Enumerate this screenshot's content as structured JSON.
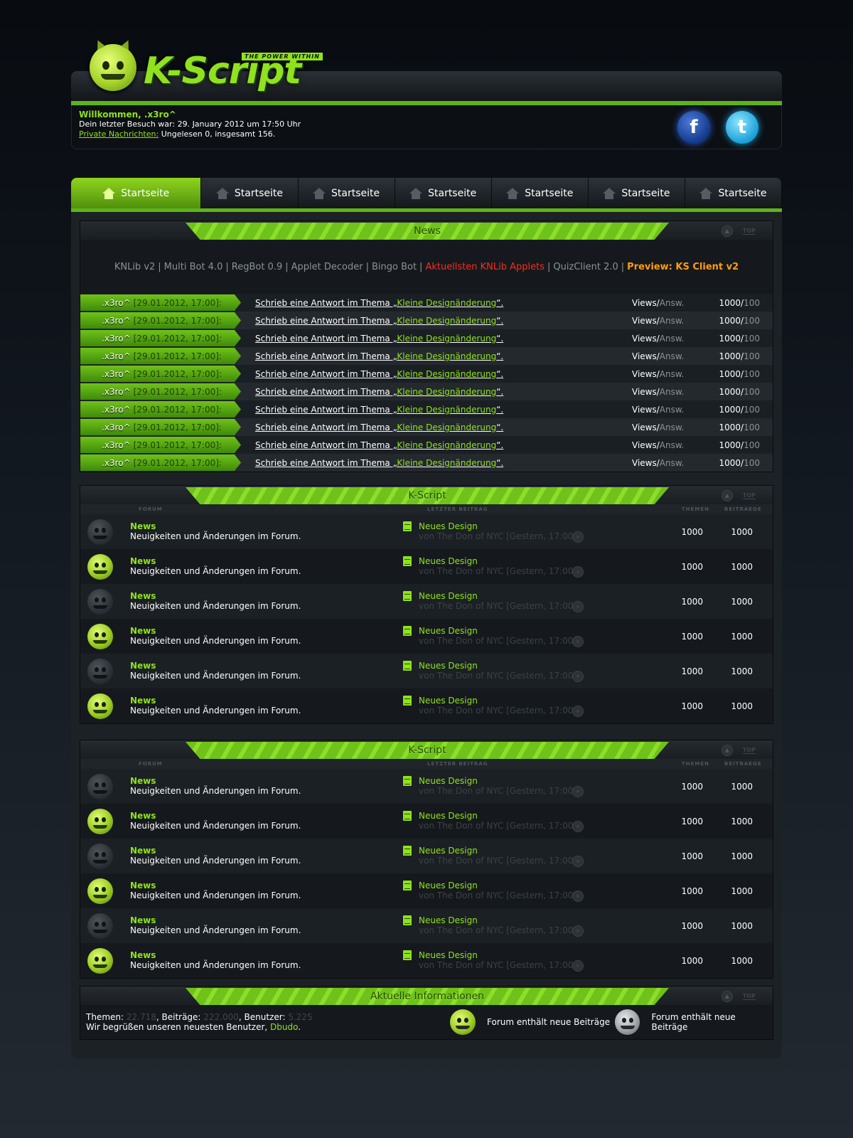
{
  "header": {
    "brand": "K-Script",
    "tagline": "THE POWER WITHIN"
  },
  "userbox": {
    "welcome": "Willkommen, .x3ro^",
    "last_visit": "Dein letzter Besuch war: 29. January 2012 um 17:50 Uhr",
    "pm_label": "Private Nachrichten:",
    "pm_text": " Ungelesen 0, insgesamt 156."
  },
  "social": {
    "facebook": "f",
    "twitter": "t"
  },
  "nav": {
    "tabs": [
      "Startseite",
      "Startseite",
      "Startseite",
      "Startseite",
      "Startseite",
      "Startseite",
      "Startseite"
    ]
  },
  "panel_tools": {
    "top_label": "TOP"
  },
  "news": {
    "title": "News",
    "links": [
      {
        "label": "KNLib v2",
        "style": "lk"
      },
      {
        "label": "Multi Bot 4.0",
        "style": "lk"
      },
      {
        "label": "RegBot 0.9",
        "style": "lk"
      },
      {
        "label": "Applet Decoder",
        "style": "lk"
      },
      {
        "label": "Bingo Bot",
        "style": "lk"
      },
      {
        "label": "Aktuellsten KNLib Applets",
        "style": "red"
      },
      {
        "label": "QuizClient 2.0",
        "style": "lk"
      },
      {
        "label": "Preview: KS Client v2",
        "style": "orange"
      }
    ],
    "separator": "|",
    "posts": [
      {
        "user": ".x3ro^",
        "date": "[29.01.2012, 17:00]:",
        "text_prefix": "Schrieb eine Antwort im Thema „",
        "topic": "Kleine Designänderung",
        "text_suffix": "“.",
        "views_label": "Views/",
        "answ_label": "Answ.",
        "views": "1000/",
        "answers": "100"
      },
      {
        "user": ".x3ro^",
        "date": "[29.01.2012, 17:00]:",
        "text_prefix": "Schrieb eine Antwort im Thema „",
        "topic": "Kleine Designänderung",
        "text_suffix": "“.",
        "views_label": "Views/",
        "answ_label": "Answ.",
        "views": "1000/",
        "answers": "100"
      },
      {
        "user": ".x3ro^",
        "date": "[29.01.2012, 17:00]:",
        "text_prefix": "Schrieb eine Antwort im Thema „",
        "topic": "Kleine Designänderung",
        "text_suffix": "“.",
        "views_label": "Views/",
        "answ_label": "Answ.",
        "views": "1000/",
        "answers": "100"
      },
      {
        "user": ".x3ro^",
        "date": "[29.01.2012, 17:00]:",
        "text_prefix": "Schrieb eine Antwort im Thema „",
        "topic": "Kleine Designänderung",
        "text_suffix": "“.",
        "views_label": "Views/",
        "answ_label": "Answ.",
        "views": "1000/",
        "answers": "100"
      },
      {
        "user": ".x3ro^",
        "date": "[29.01.2012, 17:00]:",
        "text_prefix": "Schrieb eine Antwort im Thema „",
        "topic": "Kleine Designänderung",
        "text_suffix": "“.",
        "views_label": "Views/",
        "answ_label": "Answ.",
        "views": "1000/",
        "answers": "100"
      },
      {
        "user": ".x3ro^",
        "date": "[29.01.2012, 17:00]:",
        "text_prefix": "Schrieb eine Antwort im Thema „",
        "topic": "Kleine Designänderung",
        "text_suffix": "“.",
        "views_label": "Views/",
        "answ_label": "Answ.",
        "views": "1000/",
        "answers": "100"
      },
      {
        "user": ".x3ro^",
        "date": "[29.01.2012, 17:00]:",
        "text_prefix": "Schrieb eine Antwort im Thema „",
        "topic": "Kleine Designänderung",
        "text_suffix": "“.",
        "views_label": "Views/",
        "answ_label": "Answ.",
        "views": "1000/",
        "answers": "100"
      },
      {
        "user": ".x3ro^",
        "date": "[29.01.2012, 17:00]:",
        "text_prefix": "Schrieb eine Antwort im Thema „",
        "topic": "Kleine Designänderung",
        "text_suffix": "“.",
        "views_label": "Views/",
        "answ_label": "Answ.",
        "views": "1000/",
        "answers": "100"
      },
      {
        "user": ".x3ro^",
        "date": "[29.01.2012, 17:00]:",
        "text_prefix": "Schrieb eine Antwort im Thema „",
        "topic": "Kleine Designänderung",
        "text_suffix": "“.",
        "views_label": "Views/",
        "answ_label": "Answ.",
        "views": "1000/",
        "answers": "100"
      },
      {
        "user": ".x3ro^",
        "date": "[29.01.2012, 17:00]:",
        "text_prefix": "Schrieb eine Antwort im Thema „",
        "topic": "Kleine Designänderung",
        "text_suffix": "“.",
        "views_label": "Views/",
        "answ_label": "Answ.",
        "views": "1000/",
        "answers": "100"
      }
    ]
  },
  "forum_columns": {
    "forum": "FORUM",
    "last_post": "LETZTER BEITRAG",
    "threads": "THEMEN",
    "posts": "BEITRAEGE"
  },
  "categories": [
    {
      "title": "K-Script",
      "forums": [
        {
          "status": "off",
          "title": "News",
          "desc": "Neuigkeiten und Änderungen im Forum.",
          "last_title": "Neues Design",
          "last_by": "von The Don of NYC [Gestern, 17:00]",
          "threads": "1000",
          "posts": "1000"
        },
        {
          "status": "on",
          "title": "News",
          "desc": "Neuigkeiten und Änderungen im Forum.",
          "last_title": "Neues Design",
          "last_by": "von The Don of NYC [Gestern, 17:00]",
          "threads": "1000",
          "posts": "1000"
        },
        {
          "status": "off",
          "title": "News",
          "desc": "Neuigkeiten und Änderungen im Forum.",
          "last_title": "Neues Design",
          "last_by": "von The Don of NYC [Gestern, 17:00]",
          "threads": "1000",
          "posts": "1000"
        },
        {
          "status": "on",
          "title": "News",
          "desc": "Neuigkeiten und Änderungen im Forum.",
          "last_title": "Neues Design",
          "last_by": "von The Don of NYC [Gestern, 17:00]",
          "threads": "1000",
          "posts": "1000"
        },
        {
          "status": "off",
          "title": "News",
          "desc": "Neuigkeiten und Änderungen im Forum.",
          "last_title": "Neues Design",
          "last_by": "von The Don of NYC [Gestern, 17:00]",
          "threads": "1000",
          "posts": "1000"
        },
        {
          "status": "on",
          "title": "News",
          "desc": "Neuigkeiten und Änderungen im Forum.",
          "last_title": "Neues Design",
          "last_by": "von The Don of NYC [Gestern, 17:00]",
          "threads": "1000",
          "posts": "1000"
        }
      ]
    },
    {
      "title": "K-Script",
      "forums": [
        {
          "status": "off",
          "title": "News",
          "desc": "Neuigkeiten und Änderungen im Forum.",
          "last_title": "Neues Design",
          "last_by": "von The Don of NYC [Gestern, 17:00]",
          "threads": "1000",
          "posts": "1000"
        },
        {
          "status": "on",
          "title": "News",
          "desc": "Neuigkeiten und Änderungen im Forum.",
          "last_title": "Neues Design",
          "last_by": "von The Don of NYC [Gestern, 17:00]",
          "threads": "1000",
          "posts": "1000"
        },
        {
          "status": "off",
          "title": "News",
          "desc": "Neuigkeiten und Änderungen im Forum.",
          "last_title": "Neues Design",
          "last_by": "von The Don of NYC [Gestern, 17:00]",
          "threads": "1000",
          "posts": "1000"
        },
        {
          "status": "on",
          "title": "News",
          "desc": "Neuigkeiten und Änderungen im Forum.",
          "last_title": "Neues Design",
          "last_by": "von The Don of NYC [Gestern, 17:00]",
          "threads": "1000",
          "posts": "1000"
        },
        {
          "status": "off",
          "title": "News",
          "desc": "Neuigkeiten und Änderungen im Forum.",
          "last_title": "Neues Design",
          "last_by": "von The Don of NYC [Gestern, 17:00]",
          "threads": "1000",
          "posts": "1000"
        },
        {
          "status": "on",
          "title": "News",
          "desc": "Neuigkeiten und Änderungen im Forum.",
          "last_title": "Neues Design",
          "last_by": "von The Don of NYC [Gestern, 17:00]",
          "threads": "1000",
          "posts": "1000"
        }
      ]
    }
  ],
  "info": {
    "title": "Aktuelle Informationen",
    "threads_label": "Themen: ",
    "threads": "22.718",
    "posts_label": ", Beiträge: ",
    "posts": "222.000",
    "users_label": ", Benutzer: ",
    "users": "5.225",
    "welcome_text": "Wir begrüßen unseren neuesten Benutzer, ",
    "newest_user": "Dbudo",
    "welcome_end": ".",
    "legend_new": "Forum enthält neue Beiträge",
    "legend_none": "Forum enthält neue Beiträge"
  }
}
